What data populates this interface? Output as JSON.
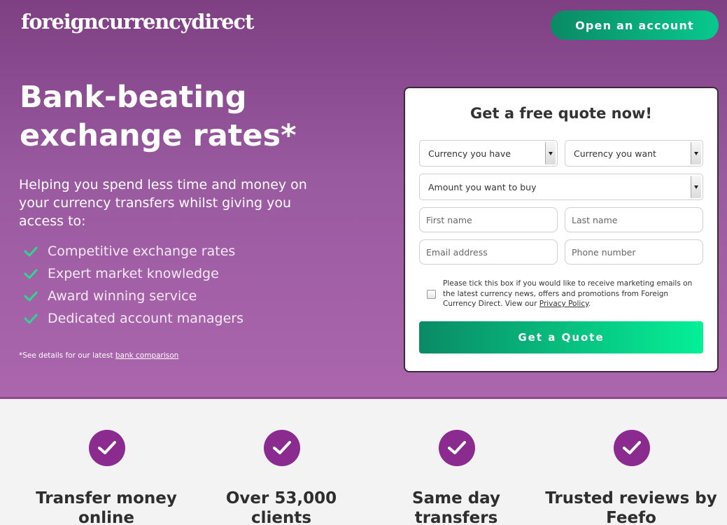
{
  "header": {
    "logo_text": "foreigncurrencydirect",
    "open_account_label": "Open an account"
  },
  "hero": {
    "headline": "Bank-beating exchange rates*",
    "subtext": "Helping you spend less time and money on your currency transfers whilst giving you access to:",
    "benefits": [
      "Competitive exchange rates",
      "Expert market knowledge",
      "Award winning service",
      "Dedicated account managers"
    ],
    "footnote_prefix": "*See details for our latest ",
    "footnote_link": "bank comparison"
  },
  "quote_form": {
    "title": "Get a free quote now!",
    "currency_have": "Currency you have",
    "currency_want": "Currency you want",
    "amount": "Amount you want to buy",
    "first_name_placeholder": "First name",
    "last_name_placeholder": "Last name",
    "email_placeholder": "Email address",
    "phone_placeholder": "Phone number",
    "consent_text": "Please tick this box if you would like to receive marketing emails on the latest currency news, offers and promotions from Foreign Currency Direct. View our ",
    "consent_link": "Privacy Policy",
    "consent_suffix": ".",
    "submit_label": "Get a Quote"
  },
  "features": [
    {
      "title": "Transfer money online"
    },
    {
      "title": "Over 53,000 clients"
    },
    {
      "title": "Same day transfers"
    },
    {
      "title": "Trusted reviews by Feefo"
    }
  ],
  "colors": {
    "hero_purple": "#9a5aa0",
    "accent_green": "#08c98d",
    "check_green": "#2fd68f",
    "badge_purple": "#8b2b8f"
  }
}
